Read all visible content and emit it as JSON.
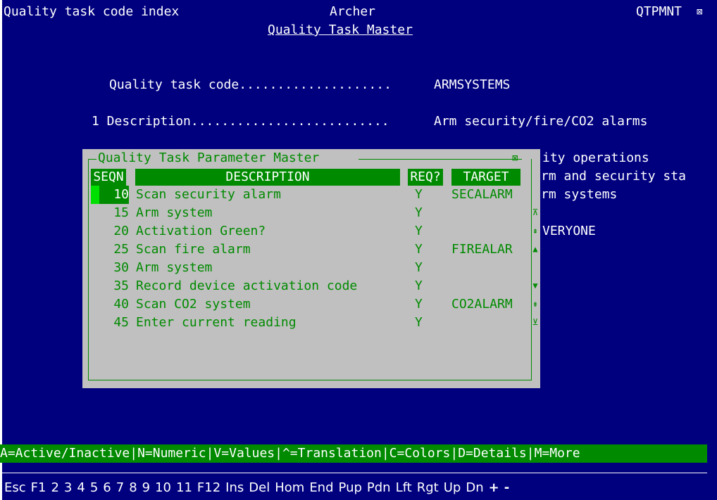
{
  "header": {
    "left": "Quality task code index",
    "center": "Archer",
    "program": "QTPMNT",
    "close_glyph": "⊠",
    "subtitle": "Quality Task Master"
  },
  "form": {
    "task_code_label": "Quality task code....................",
    "task_code_value": "ARMSYSTEMS",
    "desc_label": "1 Description..........................",
    "desc_value": "Arm security/fire/CO2 alarms"
  },
  "background_fragments": [
    "ity operations",
    "rm and security sta",
    "rm systems",
    "VERYONE"
  ],
  "popup": {
    "title": "Quality Task Parameter Master",
    "close_glyph": "⊠",
    "columns": {
      "seqn": "SEQN",
      "description": "DESCRIPTION",
      "req": "REQ?",
      "target": "TARGET"
    },
    "rows": [
      {
        "seqn": "10",
        "description": "Scan security alarm",
        "req": "Y",
        "target": "SECALARM"
      },
      {
        "seqn": "15",
        "description": "Arm system",
        "req": "Y",
        "target": ""
      },
      {
        "seqn": "20",
        "description": "Activation Green?",
        "req": "Y",
        "target": ""
      },
      {
        "seqn": "25",
        "description": "Scan fire alarm",
        "req": "Y",
        "target": "FIREALAR"
      },
      {
        "seqn": "30",
        "description": "Arm system",
        "req": "Y",
        "target": ""
      },
      {
        "seqn": "35",
        "description": "Record device activation code",
        "req": "Y",
        "target": ""
      },
      {
        "seqn": "40",
        "description": "Scan CO2 system",
        "req": "Y",
        "target": "CO2ALARM"
      },
      {
        "seqn": "45",
        "description": "Enter current reading",
        "req": "Y",
        "target": ""
      }
    ]
  },
  "scroll_glyphs": {
    "top": "⊼",
    "page_up": "⇞",
    "up": "▲",
    "down": "▼",
    "page_down": "⇟",
    "bottom": "⊻"
  },
  "command_bar": "A=Active/Inactive|N=Numeric|V=Values|^=Translation|C=Colors|D=Details|M=More",
  "keys": [
    "Esc",
    "F1",
    "2",
    "3",
    "4",
    "5",
    "6",
    "7",
    "8",
    "9",
    "10",
    "11",
    "F12",
    "Ins",
    "Del",
    "Hom",
    "End",
    "Pup",
    "Pdn",
    "Lft",
    "Rgt",
    "Up",
    "Dn",
    "+",
    "-"
  ]
}
